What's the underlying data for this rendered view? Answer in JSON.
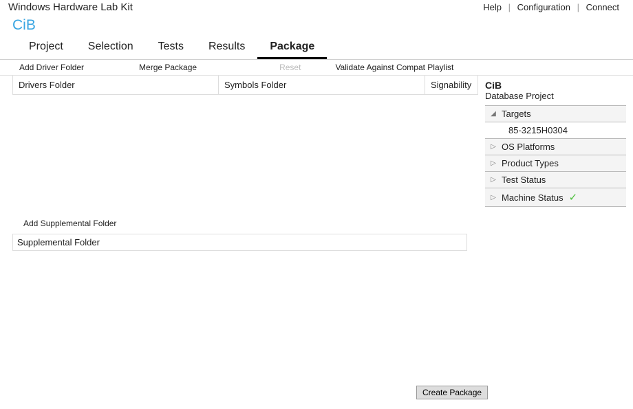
{
  "header": {
    "title": "Windows Hardware Lab Kit",
    "links": {
      "help": "Help",
      "config": "Configuration",
      "connect": "Connect"
    }
  },
  "project_title": "CiB",
  "tabs": {
    "project": "Project",
    "selection": "Selection",
    "tests": "Tests",
    "results": "Results",
    "package": "Package"
  },
  "subbar": {
    "add_driver": "Add Driver Folder",
    "merge": "Merge Package",
    "reset": "Reset",
    "validate": "Validate Against Compat Playlist"
  },
  "columns": {
    "drivers": "Drivers Folder",
    "symbols": "Symbols Folder",
    "sign": "Signability"
  },
  "supplemental": {
    "add_btn": "Add Supplemental Folder",
    "header": "Supplemental Folder"
  },
  "right": {
    "title": "CiB",
    "subtitle": "Database Project",
    "targets": "Targets",
    "target_item": "85-3215H0304",
    "os": "OS Platforms",
    "product": "Product Types",
    "test": "Test Status",
    "machine": "Machine Status"
  },
  "create_btn": "Create Package"
}
